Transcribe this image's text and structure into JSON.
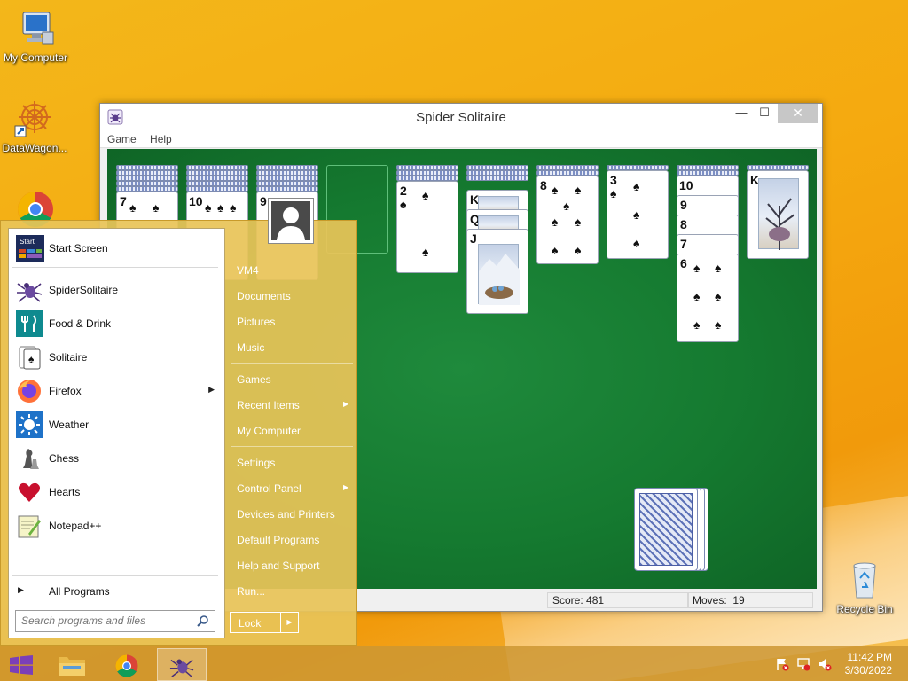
{
  "desktop": {
    "icons": [
      {
        "label": "My Computer"
      },
      {
        "label": "DataWagon..."
      },
      {
        "label": "Recycle Bin"
      }
    ]
  },
  "window": {
    "title": "Spider Solitaire",
    "menu": [
      "Game",
      "Help"
    ],
    "controls": {
      "minimize": "—",
      "maximize": "☐",
      "close": "✕"
    }
  },
  "game": {
    "score_label": "Score:",
    "score": "481",
    "moves_label": "Moves:",
    "moves": "19",
    "columns": [
      {
        "cards": [
          "7"
        ]
      },
      {
        "cards": [
          "10"
        ]
      },
      {
        "cards": [
          "9"
        ]
      },
      {
        "cards": []
      },
      {
        "cards": [
          "2"
        ]
      },
      {
        "cards": [
          "K",
          "Q",
          "J"
        ]
      },
      {
        "cards": [
          "8"
        ]
      },
      {
        "cards": [
          "3"
        ]
      },
      {
        "cards": [
          "10",
          "9",
          "8",
          "7",
          "6"
        ]
      },
      {
        "cards": [
          "K"
        ]
      }
    ]
  },
  "start_menu": {
    "programs": [
      {
        "label": "Start Screen",
        "icon": "start-screen-icon"
      },
      {
        "label": "SpiderSolitaire",
        "icon": "spider-icon"
      },
      {
        "label": "Food & Drink",
        "icon": "food-drink-icon"
      },
      {
        "label": "Solitaire",
        "icon": "solitaire-icon"
      },
      {
        "label": "Firefox",
        "icon": "firefox-icon"
      },
      {
        "label": "Weather",
        "icon": "weather-icon"
      },
      {
        "label": "Chess",
        "icon": "chess-icon"
      },
      {
        "label": "Hearts",
        "icon": "hearts-icon"
      },
      {
        "label": "Notepad++",
        "icon": "notepadpp-icon"
      }
    ],
    "start_tile_text": "Start",
    "all_programs": "All Programs",
    "search_placeholder": "Search programs and files",
    "right_links": [
      {
        "label": "VM4"
      },
      {
        "label": "Documents"
      },
      {
        "label": "Pictures"
      },
      {
        "label": "Music"
      },
      {
        "label": "Games"
      },
      {
        "label": "Recent Items"
      },
      {
        "label": "My Computer"
      },
      {
        "label": "Settings"
      },
      {
        "label": "Control Panel"
      },
      {
        "label": "Devices and Printers"
      },
      {
        "label": "Default Programs"
      },
      {
        "label": "Help and Support"
      },
      {
        "label": "Run..."
      }
    ],
    "lock": "Lock"
  },
  "taskbar": {
    "time": "11:42 PM",
    "date": "3/30/2022"
  }
}
